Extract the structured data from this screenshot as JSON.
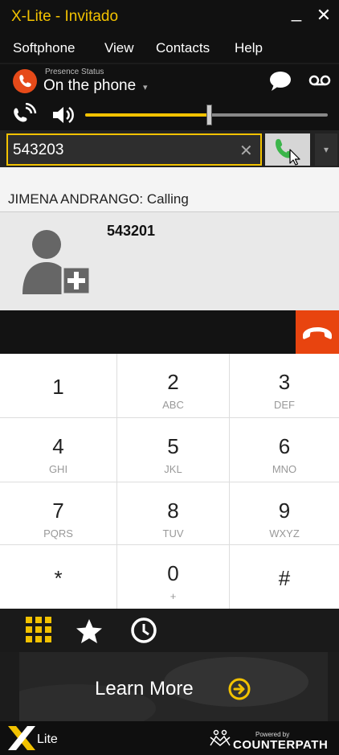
{
  "window": {
    "title": "X-Lite - Invitado",
    "minimize_label": "_",
    "close_label": "✕"
  },
  "menu": {
    "items": [
      "Softphone",
      "View",
      "Contacts",
      "Help"
    ]
  },
  "presence": {
    "small_label": "Presence Status",
    "status": "On the phone",
    "caret": "▾"
  },
  "volume": {
    "level_fraction": 0.51
  },
  "dialer": {
    "value": "543203",
    "clear_label": "✕",
    "caret": "▾"
  },
  "call": {
    "status_line": "JIMENA ANDRANGO: Calling",
    "number": "543201"
  },
  "keypad": [
    {
      "digit": "1",
      "letters": ""
    },
    {
      "digit": "2",
      "letters": "ABC"
    },
    {
      "digit": "3",
      "letters": "DEF"
    },
    {
      "digit": "4",
      "letters": "GHI"
    },
    {
      "digit": "5",
      "letters": "JKL"
    },
    {
      "digit": "6",
      "letters": "MNO"
    },
    {
      "digit": "7",
      "letters": "PQRS"
    },
    {
      "digit": "8",
      "letters": "TUV"
    },
    {
      "digit": "9",
      "letters": "WXYZ"
    },
    {
      "digit": "*",
      "letters": ""
    },
    {
      "digit": "0",
      "letters": "+"
    },
    {
      "digit": "#",
      "letters": ""
    }
  ],
  "promo": {
    "label": "Learn More"
  },
  "footer": {
    "brand_suffix": "Lite",
    "powered_by": "Powered by",
    "company": "COUNTERPATH"
  },
  "colors": {
    "accent": "#f2c200",
    "hangup": "#e8440f",
    "call_green": "#3bb54a"
  },
  "icons": [
    "chat-icon",
    "voicemail-icon",
    "phone-volume-icon",
    "speaker-icon",
    "call-icon",
    "hangup-icon",
    "add-contact-icon",
    "dialpad-grid-icon",
    "favorites-star-icon",
    "history-clock-icon",
    "arrow-right-circle-icon"
  ]
}
